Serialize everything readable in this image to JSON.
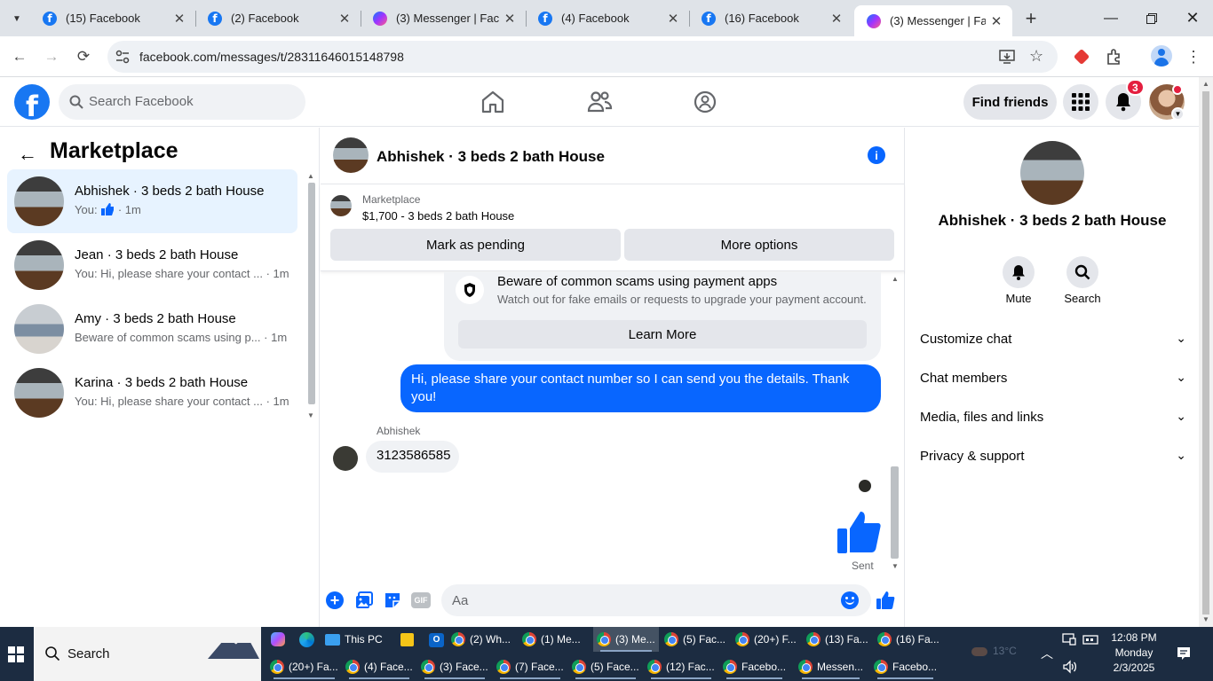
{
  "browser": {
    "tabs": [
      {
        "title": "(15) Facebook",
        "icon": "facebook-icon"
      },
      {
        "title": "(2) Facebook",
        "icon": "facebook-icon"
      },
      {
        "title": "(3) Messenger | Faceb",
        "icon": "messenger-icon"
      },
      {
        "title": "(4) Facebook",
        "icon": "facebook-icon"
      },
      {
        "title": "(16) Facebook",
        "icon": "facebook-icon"
      },
      {
        "title": "(3) Messenger | Faceb",
        "icon": "messenger-icon"
      }
    ],
    "active_tab": 5,
    "url": "facebook.com/messages/t/28311646015148798"
  },
  "fb_header": {
    "search_placeholder": "Search Facebook",
    "find_friends": "Find friends",
    "notif_count": "3",
    "brand_color": "#1877f2"
  },
  "left": {
    "title": "Marketplace",
    "conversations": [
      {
        "name": "Abhishek · 3 beds 2 bath House",
        "preview": "You:",
        "time": "· 1m",
        "selected": true
      },
      {
        "name": "Jean · 3 beds 2 bath House",
        "preview": "You: Hi, please share your contact ... · 1m"
      },
      {
        "name": "Amy · 3 beds 2 bath House",
        "preview": "Beware of common scams using p... · 1m"
      },
      {
        "name": "Karina · 3 beds 2 bath House",
        "preview": "You: Hi, please share your contact ... · 1m"
      }
    ]
  },
  "chat": {
    "title": "Abhishek · 3 beds 2 bath House",
    "listing_source": "Marketplace",
    "listing_price": "$1,700 - 3 beds 2 bath House",
    "mark_pending": "Mark as pending",
    "more_options": "More options",
    "scam_title": "Beware of common scams using payment apps",
    "scam_desc": "Watch out for fake emails or requests to upgrade your payment account.",
    "learn_more": "Learn More",
    "my_message": "Hi, please share your contact number so I can send you the details. Thank you!",
    "sender_name": "Abhishek",
    "their_message": "3123586585",
    "sent_label": "Sent",
    "input_placeholder": "Aa",
    "gif_label": "GIF",
    "accent": "#0866ff"
  },
  "right": {
    "name": "Abhishek · 3 beds 2 bath House",
    "mute": "Mute",
    "search": "Search",
    "rows": [
      "Customize chat",
      "Chat members",
      "Media, files and links",
      "Privacy & support"
    ]
  },
  "taskbar": {
    "search": "Search",
    "this_pc": "This PC",
    "row1": [
      "(2) Wh...",
      "(1) Me...",
      "(3) Me...",
      "(5) Fac...",
      "(20+) F...",
      "(13) Fa...",
      "(16) Fa..."
    ],
    "row2": [
      "(20+) Fa...",
      "(4) Face...",
      "(3) Face...",
      "(7) Face...",
      "(5) Face...",
      "(12) Fac...",
      "Facebo...",
      "Messen...",
      "Facebo..."
    ],
    "weather": "13°C",
    "time": "12:08 PM",
    "day": "Monday",
    "date": "2/3/2025"
  }
}
